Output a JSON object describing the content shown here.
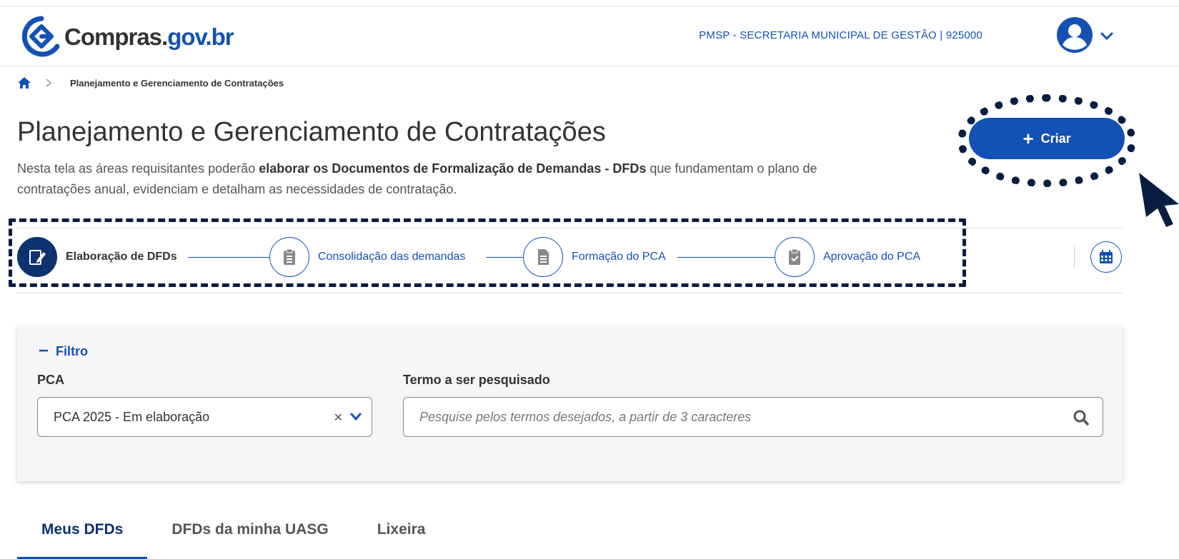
{
  "header": {
    "logo_part1": "Compras.",
    "logo_part2": "gov.br",
    "organization": "PMSP - SECRETARIA MUNICIPAL DE GESTÃO | 925000"
  },
  "breadcrumb": {
    "current": "Planejamento e Gerenciamento de Contratações"
  },
  "page": {
    "title": "Planejamento e Gerenciamento de Contratações",
    "desc_before": "Nesta tela as áreas requisitantes poderão ",
    "desc_bold": "elaborar os Documentos de Formalização de Demandas - DFDs",
    "desc_after": " que fundamentam o plano de contratações anual, evidenciam e detalham as necessidades de contratação.",
    "create_label": "Criar"
  },
  "stepper": {
    "steps": [
      {
        "label": "Elaboração de DFDs",
        "active": true
      },
      {
        "label": "Consolidação das demandas",
        "active": false
      },
      {
        "label": "Formação do PCA",
        "active": false
      },
      {
        "label": "Aprovação do PCA",
        "active": false
      }
    ]
  },
  "filter": {
    "toggle_label": "Filtro",
    "pca_label": "PCA",
    "pca_value": "PCA 2025 - Em elaboração",
    "search_label": "Termo a ser pesquisado",
    "search_placeholder": "Pesquise pelos termos desejados, a partir de 3 caracteres"
  },
  "tabs": [
    {
      "label": "Meus DFDs",
      "active": true
    },
    {
      "label": "DFDs da minha UASG",
      "active": false
    },
    {
      "label": "Lixeira",
      "active": false
    }
  ],
  "colors": {
    "primary": "#1351b4",
    "dark_blue": "#0c326f",
    "highlight": "#071d41"
  }
}
